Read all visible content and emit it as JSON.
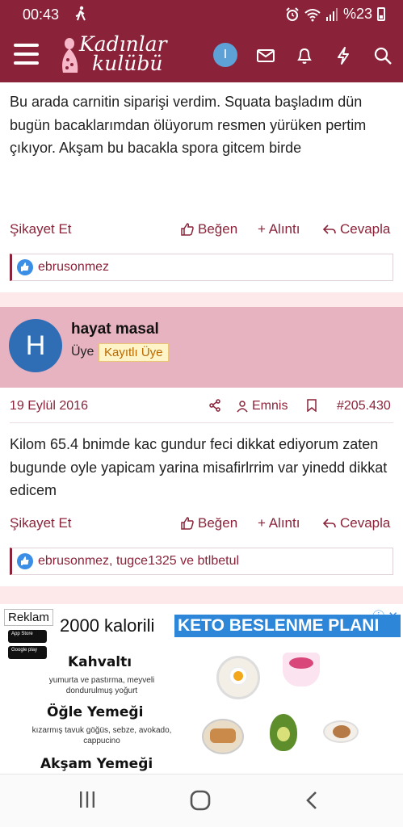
{
  "status_bar": {
    "time": "00:43",
    "battery": "%23"
  },
  "header": {
    "logo_line1": "Kadınlar",
    "logo_line2": "kulübü",
    "user_initial": "I"
  },
  "posts": [
    {
      "text": "Bu arada carnitin siparişi verdim. Squata başladım dün bugün bacaklarımdan ölüyorum resmen yürüken pertim çıkıyor. Akşam bu bacakla spora gitcem birde",
      "report_label": "Şikayet Et",
      "like_label": "Beğen",
      "quote_label": "+ Alıntı",
      "reply_label": "Cevapla",
      "liked_by": "ebrusonmez"
    },
    {
      "author": {
        "initial": "H",
        "name": "hayat masal",
        "role": "Üye",
        "badge": "Kayıtlı Üye"
      },
      "date": "19 Eylül 2016",
      "emnis_label": "Emnis",
      "post_number": "#205.430",
      "text": "Kilom 65.4 bnimde kac gundur feci dikkat ediyorum zaten bugunde oyle yapicam yarina misafirlrrim var yinedd dikkat edicem",
      "report_label": "Şikayet Et",
      "like_label": "Beğen",
      "quote_label": "+ Alıntı",
      "reply_label": "Cevapla",
      "liked_by": "ebrusonmez, tugce1325 ve btlbetul"
    }
  ],
  "ad": {
    "label": "Reklam",
    "headline_prefix": "2000 kalorili",
    "headline_highlight": "KETO BESLENME PLANI",
    "app_store": "App Store",
    "google_play": "Google play",
    "meals": [
      {
        "title": "Kahvaltı",
        "desc": "yumurta ve pastırma, meyveli dondurulmuş yoğurt"
      },
      {
        "title": "Öğle Yemeği",
        "desc": "kızarmış tavuk göğüs, sebze, avokado, cappucino"
      },
      {
        "title": "Akşam Yemeği",
        "desc": ""
      }
    ]
  },
  "colors": {
    "brand": "#8a2339",
    "user_header_bg": "#e8b3c0",
    "ad_highlight": "#2d86d8"
  }
}
